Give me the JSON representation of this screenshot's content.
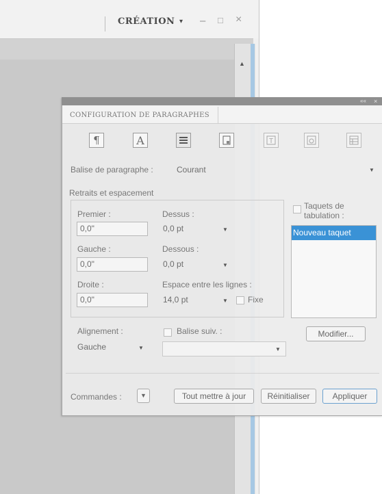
{
  "app": {
    "workspace_label": "CRÉATION",
    "workspace_caret": "▾",
    "minimize": "–",
    "maximize": "□",
    "close": "×",
    "scroll_up": "▲"
  },
  "panel": {
    "title": "CONFIGURATION DE PARAGRAPHES",
    "collapse": "««",
    "close": "×",
    "icons": [
      "pilcrow-icon",
      "char-A-icon",
      "para-lines-icon",
      "page-icon",
      "text-frame-icon",
      "ligature-icon",
      "table-icon"
    ],
    "paragraph_tag_label": "Balise de paragraphe :",
    "paragraph_tag_value": "Courant",
    "indents_section": "Retraits et espacement",
    "premier_label": "Premier :",
    "premier_value": "0,0\"",
    "dessus_label": "Dessus :",
    "dessus_value": "0,0 pt",
    "gauche_label": "Gauche :",
    "gauche_value": "0,0\"",
    "dessous_label": "Dessous :",
    "dessous_value": "0,0 pt",
    "droite_label": "Droite :",
    "droite_value": "0,0\"",
    "line_spacing_label": "Espace entre les lignes :",
    "line_spacing_value": "14,0 pt",
    "fixe_label": "Fixe",
    "tabs_label": "Taquets de tabulation :",
    "tabs_items": [
      "Nouveau taquet"
    ],
    "alignment_label": "Alignement :",
    "alignment_value": "Gauche",
    "next_tag_label": "Balise suiv. :",
    "modify_button": "Modifier...",
    "commands_label": "Commandes :",
    "update_all_button": "Tout mettre à jour",
    "reset_button": "Réinitialiser",
    "apply_button": "Appliquer"
  },
  "colors": {
    "selection_blue": "#3a92d6",
    "panel_bg": "#ececec",
    "doc_gray": "#c9c9c9"
  }
}
